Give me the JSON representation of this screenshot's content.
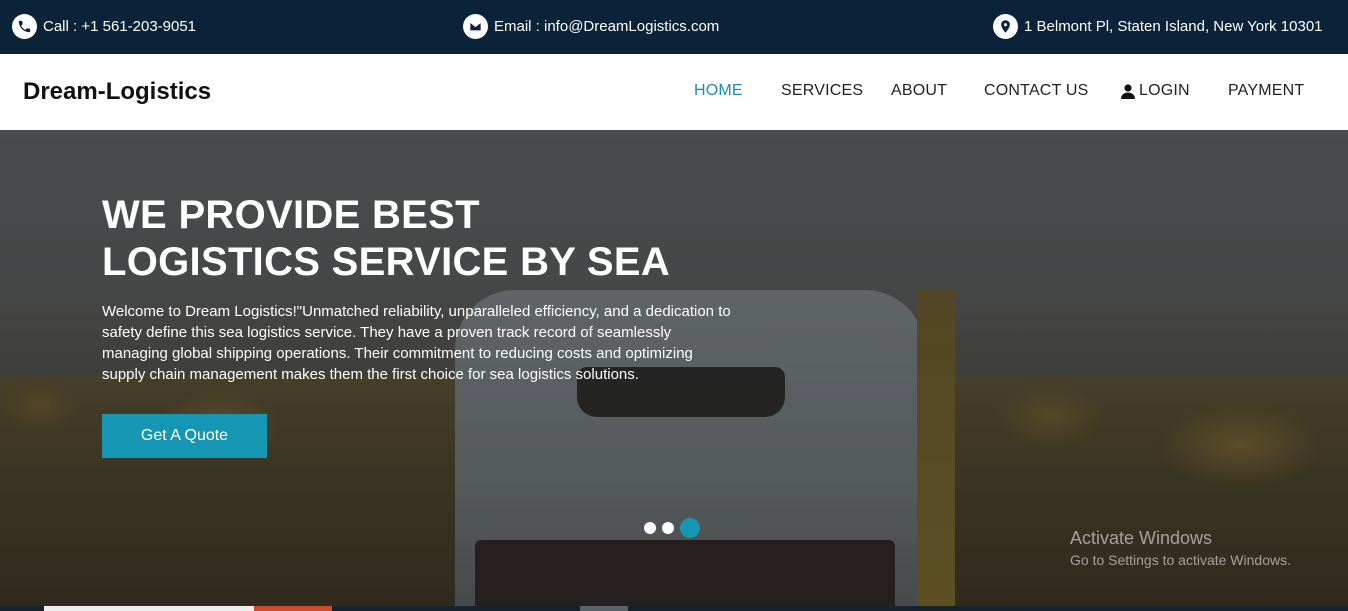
{
  "topbar": {
    "call": "Call : +1 561-203-9051",
    "email": "Email : info@DreamLogistics.com",
    "address": "1 Belmont Pl, Staten Island, New York 10301"
  },
  "navbar": {
    "brand": "Dream-Logistics",
    "items": [
      {
        "label": "HOME",
        "active": true
      },
      {
        "label": "SERVICES"
      },
      {
        "label": "ABOUT"
      },
      {
        "label": "CONTACT US"
      },
      {
        "label": "LOGIN",
        "icon": "user-icon"
      },
      {
        "label": "PAYMENT"
      }
    ]
  },
  "hero": {
    "title_line1": "WE PROVIDE BEST",
    "title_line2": "LOGISTICS SERVICE BY SEA",
    "text": "Welcome to Dream Logistics!\"Unmatched reliability, unparalleled efficiency, and a dedication to safety define this sea logistics service. They have a proven track record of seamlessly managing global shipping operations. Their commitment to reducing costs and optimizing supply chain management makes them the first choice for sea logistics solutions.",
    "button": "Get A Quote",
    "slides": 3,
    "active_slide": 3
  },
  "watermark": {
    "title": "Activate Windows",
    "subtitle": "Go to Settings to activate Windows."
  },
  "colors": {
    "topbar_bg": "#0a2338",
    "accent": "#1597b3",
    "nav_active": "#1a8ea8"
  }
}
